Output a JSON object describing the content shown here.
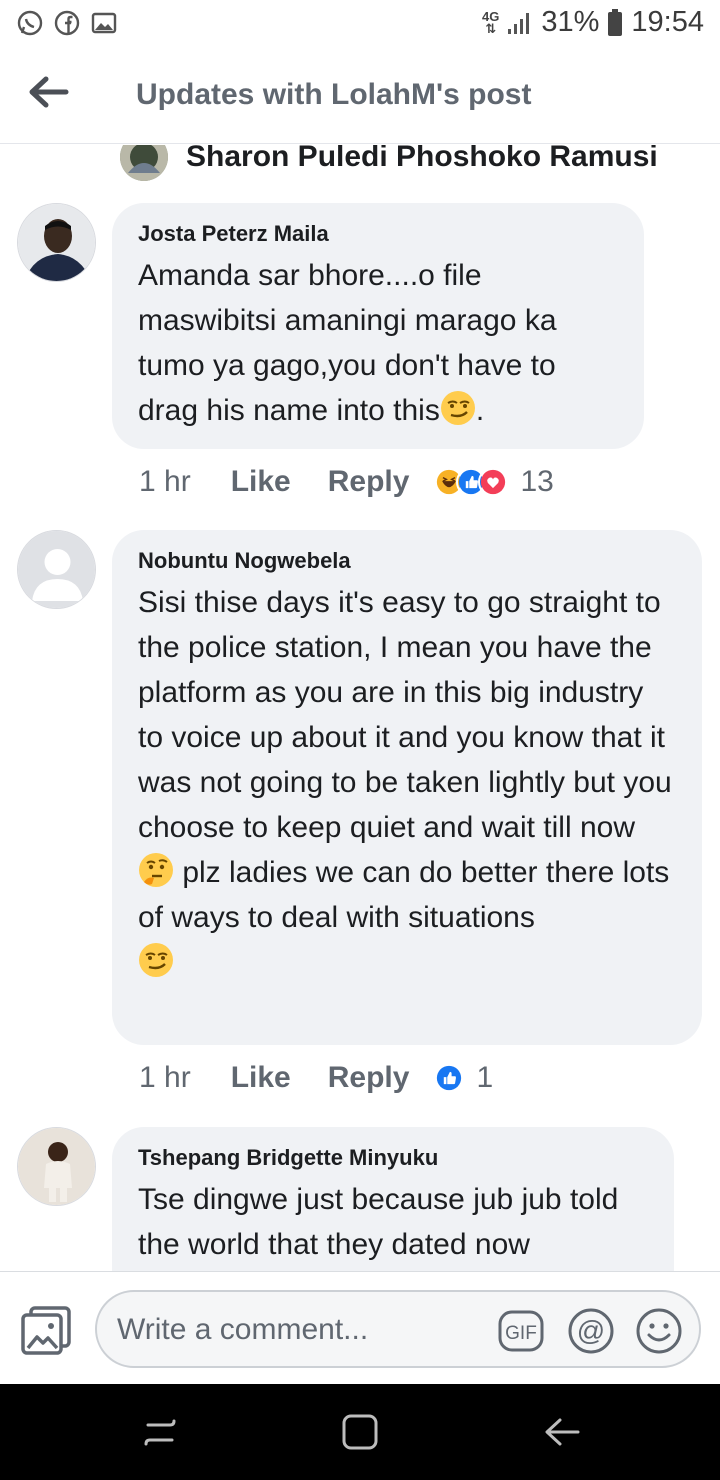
{
  "status_bar": {
    "network": "4G",
    "battery": "31%",
    "time": "19:54",
    "icons": [
      "whatsapp-icon",
      "facebook-icon",
      "gallery-icon",
      "signal-icon",
      "battery-icon"
    ]
  },
  "header": {
    "title": "Updates with LolahM's post",
    "back_icon": "back-arrow-icon"
  },
  "partial_comment": {
    "author": "Sharon Puledi Phoshoko Ramusi"
  },
  "comments": [
    {
      "author": "Josta Peterz Maila",
      "text_parts": [
        "Amanda sar bhore....o file maswibitsi amaningi marago ka tumo ya gago,you don't have to drag his name into this",
        "."
      ],
      "inline_emoji": "smirk-emoji",
      "time": "1 hr",
      "like": "Like",
      "reply": "Reply",
      "reaction_icons": [
        "haha-reaction",
        "like-reaction",
        "love-reaction"
      ],
      "reaction_count": "13"
    },
    {
      "author": "Nobuntu Nogwebela",
      "text_parts": [
        "Sisi thise days it's easy to go straight to the police station, I mean you have the platform as you are in this big industry to voice up about it and you know that it was not going to be taken lightly but you choose to keep quiet and wait till now ",
        " plz ladies we can do better there lots of ways to deal with situations"
      ],
      "inline_emoji": "thinking-emoji",
      "trailing_emoji": "smirk-emoji",
      "time": "1 hr",
      "like": "Like",
      "reply": "Reply",
      "reaction_icons": [
        "like-reaction"
      ],
      "reaction_count": "1"
    },
    {
      "author": "Tshepang Bridgette Minyuku",
      "text": "Tse dingwe just because jub jub told the world that they dated now"
    }
  ],
  "composer": {
    "placeholder": "Write a comment...",
    "gif_label": "GIF",
    "icons": [
      "photo-icon",
      "gif-icon",
      "mention-icon",
      "emoji-icon"
    ]
  },
  "colors": {
    "bubble": "#f0f2f5",
    "text": "#1c1e21",
    "secondary": "#606770",
    "like_blue": "#1877f2",
    "love_red": "#f33e58",
    "haha_yellow": "#f7b125"
  }
}
